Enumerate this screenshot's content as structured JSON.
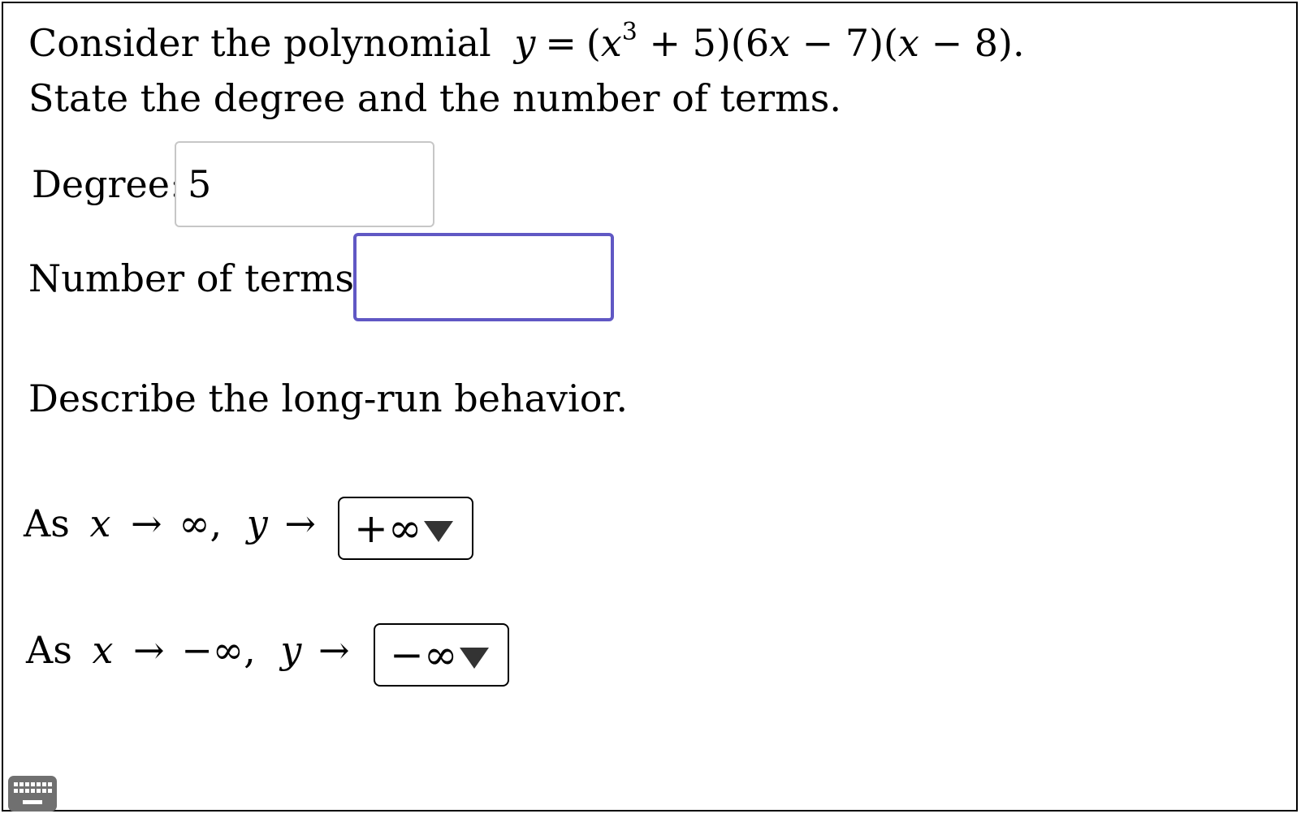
{
  "question": {
    "intro": "Consider the polynomial",
    "poly_y": "y",
    "poly_eq": "=",
    "poly_f1_open": "(",
    "poly_x": "x",
    "poly_exp": "3",
    "poly_f1_rest": "+ 5)(6",
    "poly_x2": "x",
    "poly_f2_rest": "− 7)(",
    "poly_x3": "x",
    "poly_f3_rest": "− 8).",
    "instruction": "State the degree and the number of terms."
  },
  "degree": {
    "label": "Degree:",
    "value": "5"
  },
  "terms": {
    "label": "Number of terms:",
    "value": ""
  },
  "long_run": {
    "heading": "Describe the long-run behavior.",
    "pos": {
      "as": "As",
      "x": "x",
      "arrow1": "→",
      "limit": "∞,",
      "y": "y",
      "arrow2": "→",
      "selected": "+∞"
    },
    "neg": {
      "as": "As",
      "x": "x",
      "arrow1": "→",
      "limit": "−∞,",
      "y": "y",
      "arrow2": "→",
      "selected": "−∞"
    }
  },
  "icons": {
    "keyboard": "keyboard-icon",
    "caret": "caret-down-icon"
  },
  "colors": {
    "focus_border": "#6058c4",
    "inactive_border": "#c7c7c7",
    "keyboard_bg": "#707070"
  }
}
